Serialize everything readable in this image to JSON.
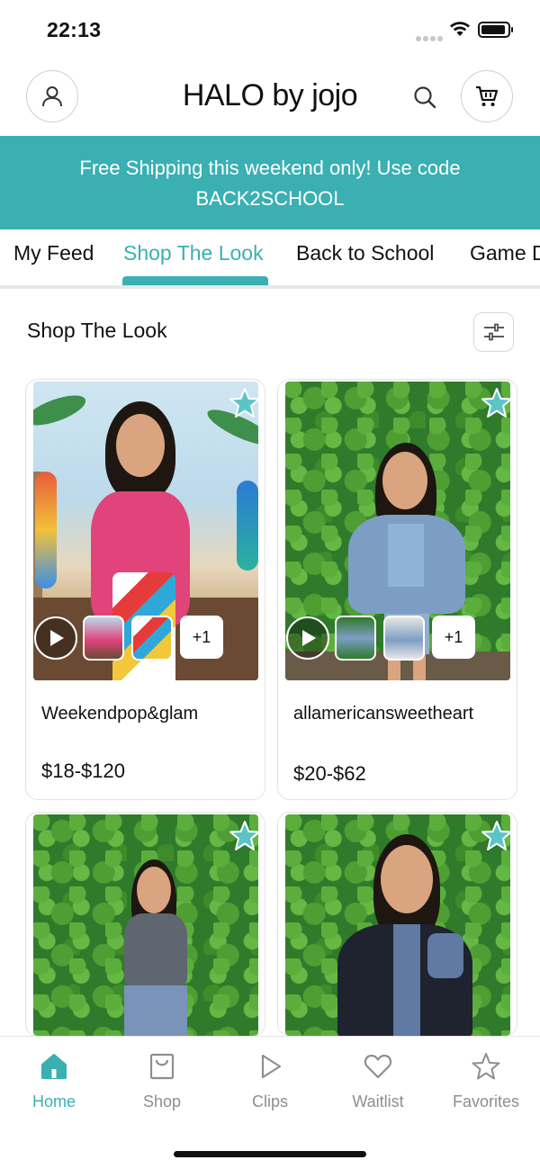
{
  "status_bar": {
    "time": "22:13"
  },
  "header": {
    "title": "HALO by jojo"
  },
  "promo": {
    "line1": "Free Shipping this weekend only! Use code",
    "line2": "BACK2SCHOOL"
  },
  "tabs": [
    {
      "label": "My Feed",
      "active": false
    },
    {
      "label": "Shop The Look",
      "active": true
    },
    {
      "label": "Back to School",
      "active": false
    },
    {
      "label": "Game D",
      "active": false
    }
  ],
  "section": {
    "title": "Shop The Look"
  },
  "products": [
    {
      "name": "Weekendpop&glam",
      "price": "$18-$120",
      "more_label": "+1"
    },
    {
      "name": "allamericansweetheart",
      "price": "$20-$62",
      "more_label": "+1"
    },
    {
      "name": "",
      "price": ""
    },
    {
      "name": "",
      "price": ""
    }
  ],
  "bottom_nav": [
    {
      "label": "Home",
      "icon": "home-icon",
      "active": true
    },
    {
      "label": "Shop",
      "icon": "shopping-bag-icon",
      "active": false
    },
    {
      "label": "Clips",
      "icon": "play-icon",
      "active": false
    },
    {
      "label": "Waitlist",
      "icon": "heart-icon",
      "active": false
    },
    {
      "label": "Favorites",
      "icon": "star-icon",
      "active": false
    }
  ],
  "colors": {
    "accent": "#3ab0b3",
    "inactive": "#8e8e8e",
    "border": "#e3e3e3"
  }
}
